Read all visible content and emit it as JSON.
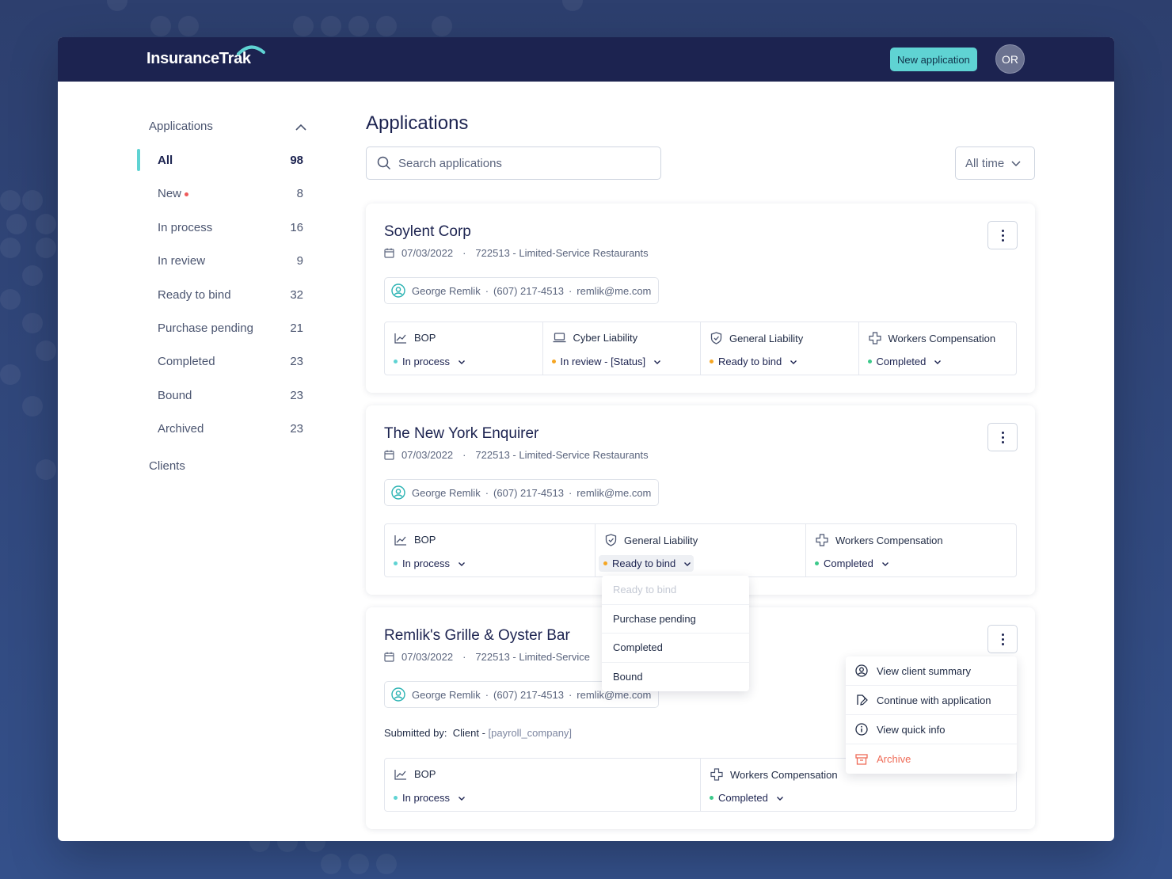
{
  "header": {
    "logo": "InsuranceTrak",
    "new_application_label": "New application",
    "avatar_initials": "OR"
  },
  "sidebar": {
    "section_label": "Applications",
    "items": [
      {
        "label": "All",
        "count": "98"
      },
      {
        "label": "New",
        "count": "8"
      },
      {
        "label": "In process",
        "count": "16"
      },
      {
        "label": "In review",
        "count": "9"
      },
      {
        "label": "Ready to bind",
        "count": "32"
      },
      {
        "label": "Purchase pending",
        "count": "21"
      },
      {
        "label": "Completed",
        "count": "23"
      },
      {
        "label": "Bound",
        "count": "23"
      },
      {
        "label": "Archived",
        "count": "23"
      }
    ],
    "clients_label": "Clients"
  },
  "main": {
    "title": "Applications",
    "search_placeholder": "Search applications",
    "time_filter": "All time"
  },
  "colors": {
    "accent": "#5fd3d3",
    "header_bg": "#1c2350",
    "status_teal": "#5fd3d3",
    "status_orange": "#f5a623",
    "status_green": "#3cc98a",
    "danger": "#ef6b57"
  },
  "cards": [
    {
      "title": "Soylent Corp",
      "date": "07/03/2022",
      "sep": "·",
      "industry": "722513 - Limited-Service Restaurants",
      "contact": {
        "name": "George Remlik",
        "phone": "(607) 217-4513",
        "email": "remlik@me.com",
        "dot": "·"
      },
      "products": [
        {
          "name": "BOP",
          "icon": "chart-line-icon",
          "status": "In process",
          "status_color": "#5fd3d3"
        },
        {
          "name": "Cyber Liability",
          "icon": "laptop-icon",
          "status": "In review - [Status]",
          "status_color": "#f5a623"
        },
        {
          "name": "General Liability",
          "icon": "shield-icon",
          "status": "Ready to bind",
          "status_color": "#f5a623"
        },
        {
          "name": "Workers Compensation",
          "icon": "medical-cross-icon",
          "status": "Completed",
          "status_color": "#3cc98a"
        }
      ]
    },
    {
      "title": "The New York Enquirer",
      "date": "07/03/2022",
      "sep": "·",
      "industry": "722513 - Limited-Service Restaurants",
      "contact": {
        "name": "George Remlik",
        "phone": "(607) 217-4513",
        "email": "remlik@me.com",
        "dot": "·"
      },
      "products": [
        {
          "name": "BOP",
          "icon": "chart-line-icon",
          "status": "In process",
          "status_color": "#5fd3d3"
        },
        {
          "name": "General Liability",
          "icon": "shield-icon",
          "status": "Ready to bind",
          "status_color": "#f5a623"
        },
        {
          "name": "Workers Compensation",
          "icon": "medical-cross-icon",
          "status": "Completed",
          "status_color": "#3cc98a"
        }
      ]
    },
    {
      "title": "Remlik's Grille & Oyster Bar",
      "date": "07/03/2022",
      "sep": "·",
      "industry": "722513 - Limited-Service",
      "contact": {
        "name": "George Remlik",
        "phone": "(607) 217-4513",
        "email": "remlik@me.com",
        "dot": "·"
      },
      "submitted_label": "Submitted by:",
      "submitted_value": "Client -",
      "submitted_placeholder": "[payroll_company]",
      "products": [
        {
          "name": "BOP",
          "icon": "chart-line-icon",
          "status": "In process",
          "status_color": "#5fd3d3"
        },
        {
          "name": "Workers Compensation",
          "icon": "medical-cross-icon",
          "status": "Completed",
          "status_color": "#3cc98a"
        }
      ]
    }
  ],
  "status_dropdown": {
    "options": [
      "Ready to bind",
      "Purchase pending",
      "Completed",
      "Bound"
    ],
    "current": "Ready to bind"
  },
  "actions_menu": {
    "items": [
      {
        "label": "View client summary",
        "icon": "user-circle-icon"
      },
      {
        "label": "Continue with application",
        "icon": "document-edit-icon"
      },
      {
        "label": "View quick info",
        "icon": "info-icon"
      },
      {
        "label": "Archive",
        "icon": "archive-icon"
      }
    ]
  }
}
